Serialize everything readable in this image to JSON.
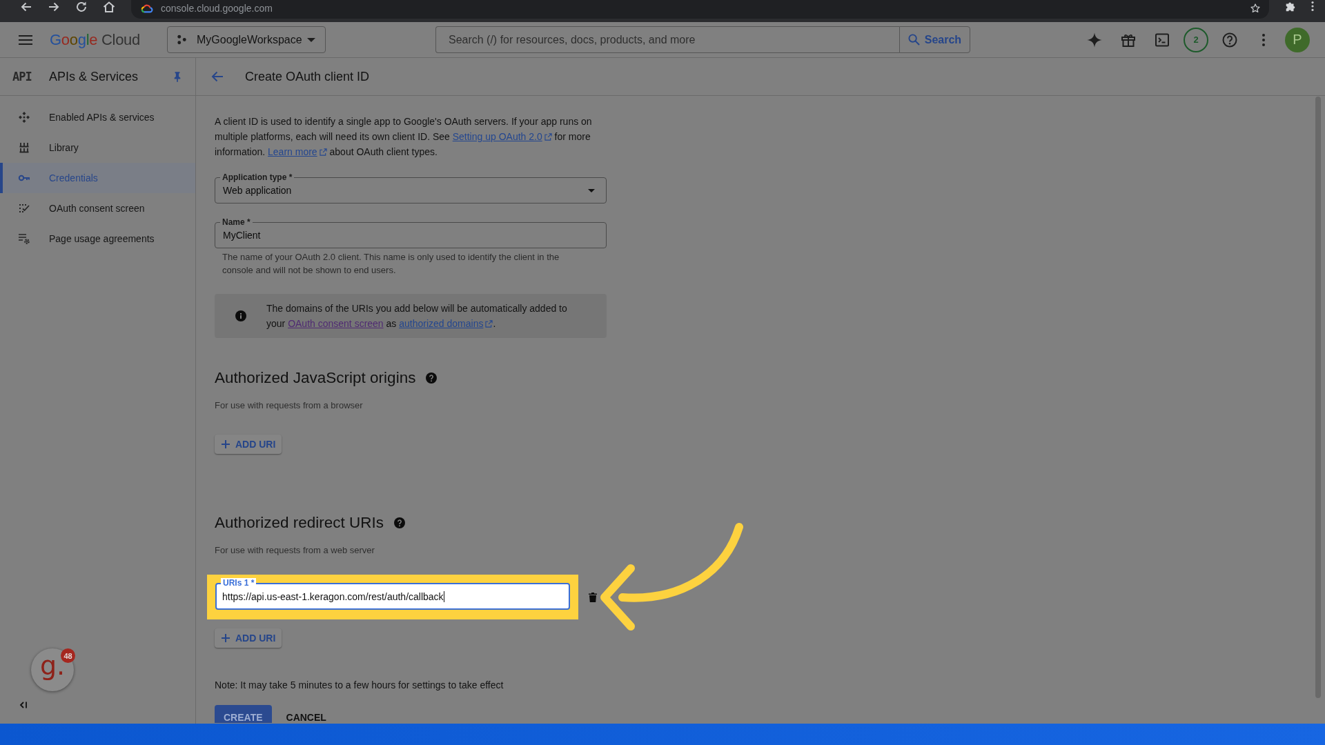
{
  "browser": {
    "url": "console.cloud.google.com"
  },
  "header": {
    "logo": {
      "brand": "Google",
      "product": "Cloud"
    },
    "project": "MyGoogleWorkspace",
    "search": {
      "placeholder": "Search (/) for resources, docs, products, and more",
      "button": "Search"
    },
    "counter": "2",
    "avatar": "P"
  },
  "sidebar": {
    "logo": "API",
    "title": "APIs & Services",
    "items": [
      {
        "label": "Enabled APIs & services",
        "selected": false
      },
      {
        "label": "Library",
        "selected": false
      },
      {
        "label": "Credentials",
        "selected": true
      },
      {
        "label": "OAuth consent screen",
        "selected": false
      },
      {
        "label": "Page usage agreements",
        "selected": false
      }
    ]
  },
  "page": {
    "title": "Create OAuth client ID"
  },
  "intro": [
    {
      "kind": "text",
      "text": "A client ID is used to identify a single app to Google's OAuth servers. If your app runs on multiple platforms, each will need its own client ID. See "
    },
    {
      "kind": "link",
      "text": "Setting up OAuth 2.0",
      "external": true,
      "visited": false
    },
    {
      "kind": "text",
      "text": " for more information. "
    },
    {
      "kind": "link",
      "text": "Learn more",
      "external": true,
      "visited": false
    },
    {
      "kind": "text",
      "text": " about OAuth client types."
    }
  ],
  "fields": [
    {
      "kind": "select",
      "label": "Application type *",
      "value": "Web application"
    },
    {
      "kind": "text",
      "label": "Name *",
      "value": "MyClient",
      "helper": "The name of your OAuth 2.0 client. This name is only used to identify the client in the console and will not be shown to end users."
    }
  ],
  "notice": [
    {
      "kind": "text",
      "text": "The domains of the URIs you add below will be automatically added to your "
    },
    {
      "kind": "link",
      "text": "OAuth consent screen",
      "external": false,
      "visited": true
    },
    {
      "kind": "text",
      "text": " as "
    },
    {
      "kind": "link",
      "text": "authorized domains",
      "external": true,
      "visited": false
    },
    {
      "kind": "text",
      "text": "."
    }
  ],
  "sections": [
    {
      "title": "Authorized JavaScript origins",
      "subtitle": "For use with requests from a browser",
      "add_button": "ADD URI"
    },
    {
      "title": "Authorized redirect URIs",
      "subtitle": "For use with requests from a web server",
      "uris": [
        {
          "label": "URIs 1 *",
          "value": "https://api.us-east-1.keragon.com/rest/auth/callback",
          "focused": true,
          "highlighted": true
        }
      ],
      "add_button": "ADD URI"
    }
  ],
  "note": "Note: It may take 5 minutes to a few hours for settings to take effect",
  "actions": [
    {
      "label": "CREATE",
      "kind": "primary"
    },
    {
      "label": "CANCEL",
      "kind": "text"
    }
  ],
  "widget": {
    "logo": "g.",
    "badge": "48"
  }
}
